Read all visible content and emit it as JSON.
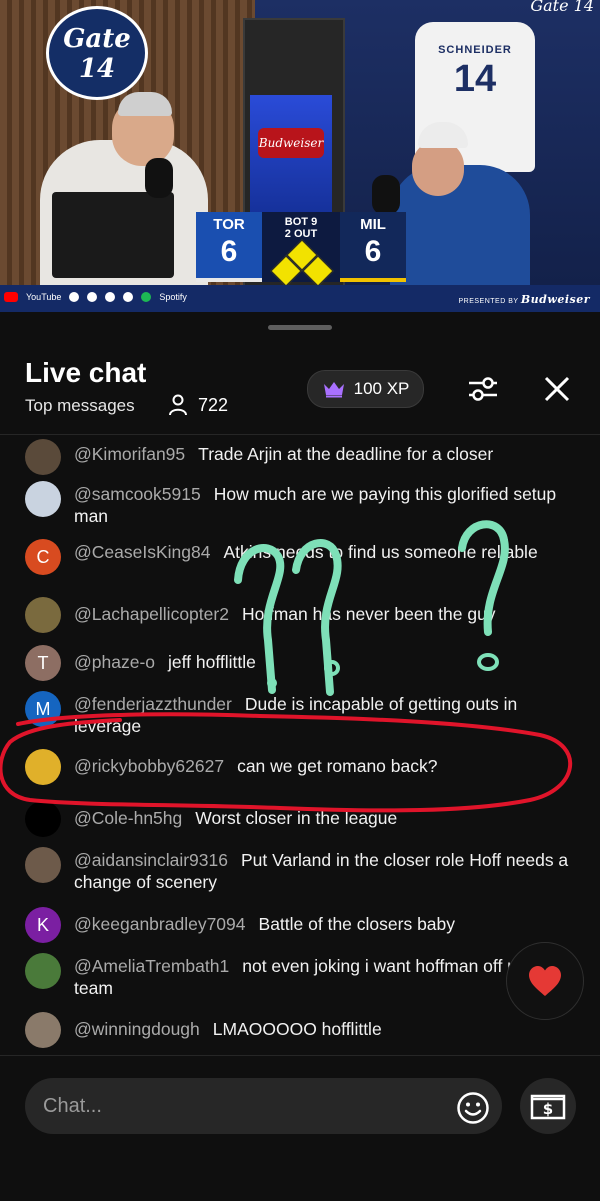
{
  "video": {
    "show_logo": "Gate 14",
    "corner_logo": "Gate 14",
    "sign": "Budweiser",
    "jersey_name": "SCHNEIDER",
    "jersey_number": "14",
    "scoreboard": {
      "away_team": "TOR",
      "away_score": "6",
      "home_team": "MIL",
      "home_score": "6",
      "inning": "BOT 9",
      "outs": "2 OUT"
    },
    "platforms": [
      "YouTube",
      "Spotify"
    ],
    "presented_by": "PRESENTED BY",
    "sponsor": "Budweiser"
  },
  "chat": {
    "title": "Live chat",
    "subtitle": "Top messages",
    "viewer_count": "722",
    "xp_label": "100 XP",
    "messages": [
      {
        "author": "@Kimorifan95",
        "text": "Trade Arjin at the deadline for a closer",
        "avatar_color": "#5a4a3a",
        "initial": ""
      },
      {
        "author": "@samcook5915",
        "text": "How much are we paying this glorified setup man",
        "avatar_color": "#c9d3e0",
        "initial": ""
      },
      {
        "author": "@CeaseIsKing84",
        "text": "Atkins needs to find us someone reliable",
        "avatar_color": "#d84b20",
        "initial": "C"
      },
      {
        "author": "@Lachapellicopter2",
        "text": "Hoffman has never been the guy",
        "avatar_color": "#7a6a3e",
        "initial": ""
      },
      {
        "author": "@phaze-o",
        "text": "jeff hofflittle",
        "avatar_color": "#8d6e63",
        "initial": "T"
      },
      {
        "author": "@fenderjazzthunder",
        "text": "Dude is incapable of getting outs in leverage",
        "avatar_color": "#1565c0",
        "initial": "M"
      },
      {
        "author": "@rickybobby62627",
        "text": "can we get romano back?",
        "avatar_color": "#e0b02a",
        "initial": ""
      },
      {
        "author": "@Cole-hn5hg",
        "text": "Worst closer in the league",
        "avatar_color": "#000000",
        "initial": ""
      },
      {
        "author": "@aidansinclair9316",
        "text": "Put Varland in the closer role Hoff needs a change of scenery",
        "avatar_color": "#6d5a4a",
        "initial": ""
      },
      {
        "author": "@keeganbradley7094",
        "text": "Battle of the closers baby",
        "avatar_color": "#7b1fa2",
        "initial": "K"
      },
      {
        "author": "@AmeliaTrembath1",
        "text": "not even joking i want hoffman off my team",
        "avatar_color": "#4a7a3a",
        "initial": ""
      },
      {
        "author": "@winningdough",
        "text": "LMAOOOOO hofflittle",
        "avatar_color": "#8a7a6a",
        "initial": ""
      }
    ],
    "input_placeholder": "Chat...",
    "icons": {
      "crown": "crown-icon",
      "person": "person-icon",
      "settings": "sliders-icon",
      "close": "close-icon",
      "emoji": "emoji-icon",
      "super_chat": "dollar-bill-icon",
      "heart": "heart-icon"
    },
    "colors": {
      "background": "#0f0f0f",
      "author": "#aaaaaa",
      "crown": "#a970ff",
      "heart": "#e53935",
      "annotation_red": "#e0142a",
      "annotation_green": "#7ee0b8"
    }
  }
}
